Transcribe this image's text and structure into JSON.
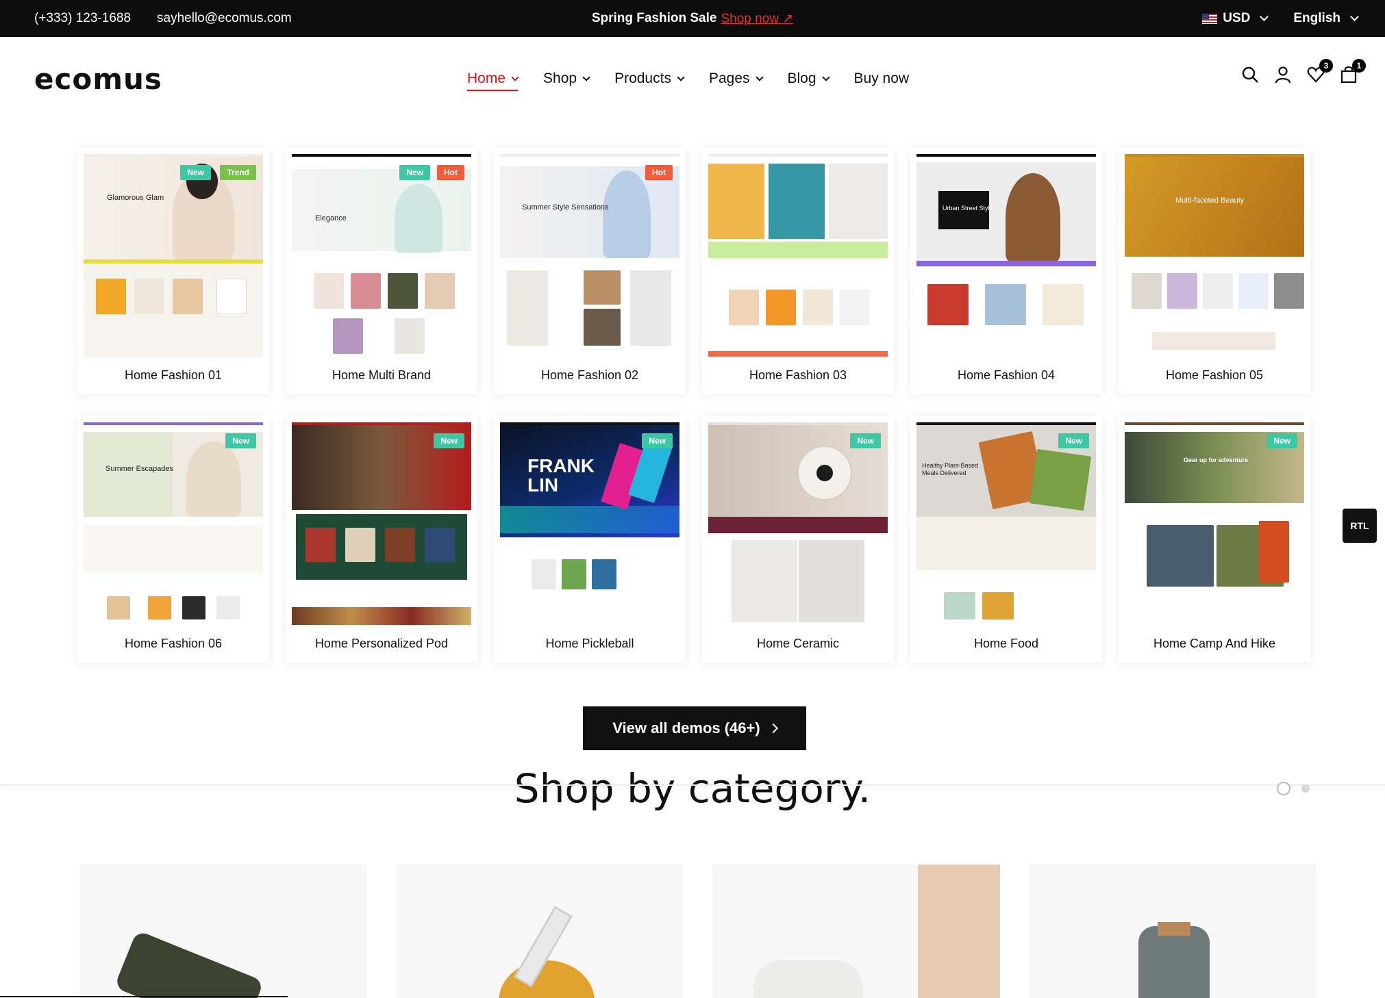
{
  "topbar": {
    "phone": "(+333) 123-1688",
    "email": "sayhello@ecomus.com",
    "promo_text": "Spring Fashion Sale",
    "promo_link": "Shop now",
    "currency": "USD",
    "language": "English"
  },
  "header": {
    "logo": "ecomus",
    "nav": [
      "Home",
      "Shop",
      "Products",
      "Pages",
      "Blog",
      "Buy now"
    ],
    "wishlist_count": "3",
    "cart_count": "1"
  },
  "demos": {
    "row1": [
      {
        "label": "Home Fashion 01",
        "tags": [
          "New",
          "Trend"
        ],
        "headline": "Glamorous Glam"
      },
      {
        "label": "Home Multi Brand",
        "tags": [
          "New",
          "Hot"
        ],
        "headline": "Elegance"
      },
      {
        "label": "Home Fashion 02",
        "tags": [
          "Hot"
        ],
        "headline": "Summer Style Sensations"
      },
      {
        "label": "Home Fashion 03",
        "tags": [],
        "headline": ""
      },
      {
        "label": "Home Fashion 04",
        "tags": [],
        "headline": "Urban Street Style"
      },
      {
        "label": "Home Fashion 05",
        "tags": [],
        "headline": "Multi-faceted Beauty"
      }
    ],
    "row2": [
      {
        "label": "Home Fashion 06",
        "tags": [
          "New"
        ],
        "headline": "Summer Escapades"
      },
      {
        "label": "Home Personalized Pod",
        "tags": [
          "New"
        ],
        "headline": ""
      },
      {
        "label": "Home Pickleball",
        "tags": [
          "New"
        ],
        "headline": "FRANK LIN"
      },
      {
        "label": "Home Ceramic",
        "tags": [
          "New"
        ],
        "headline": ""
      },
      {
        "label": "Home Food",
        "tags": [
          "New"
        ],
        "headline": "Healthy Plant-Based Meals Delivered"
      },
      {
        "label": "Home Camp And Hike",
        "tags": [
          "New"
        ],
        "headline": "Gear up for adventure"
      }
    ]
  },
  "view_all": "View all demos (46+)",
  "shop_category_title": "Shop by category.",
  "rtl": "RTL",
  "colors": {
    "accent": "#db1215",
    "new_tag": "#3dc7a3",
    "hot_tag": "#f25c3a",
    "trend_tag": "#79c24a"
  }
}
